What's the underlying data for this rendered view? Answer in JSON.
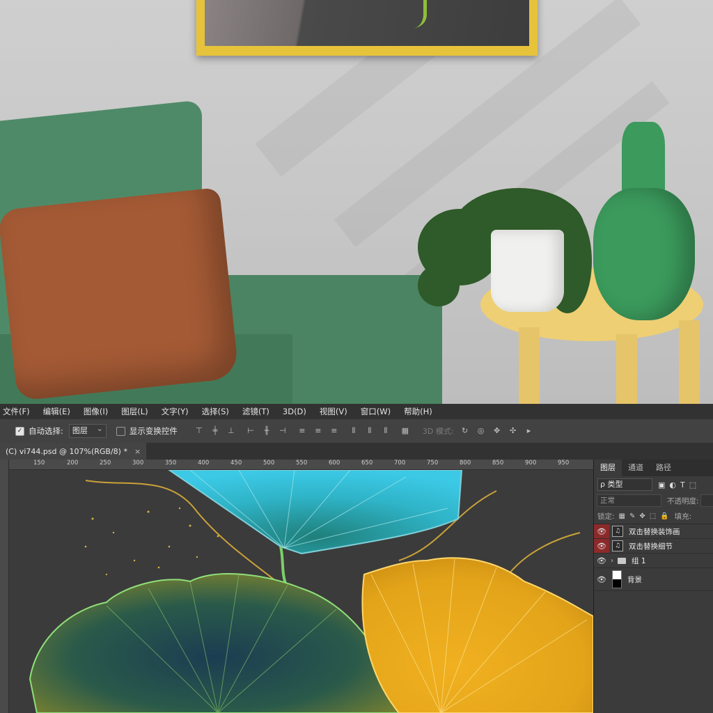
{
  "menubar": {
    "items": [
      "文件(F)",
      "编辑(E)",
      "图像(I)",
      "图层(L)",
      "文字(Y)",
      "选择(S)",
      "滤镜(T)",
      "3D(D)",
      "视图(V)",
      "窗口(W)",
      "帮助(H)"
    ]
  },
  "options": {
    "auto_select_label": "自动选择:",
    "auto_select_target": "图层",
    "show_transform_label": "显示变换控件",
    "mode_3d_label": "3D 模式:"
  },
  "document": {
    "tab_title": "(C) vi744.psd @ 107%(RGB/8) *",
    "close_glyph": "×"
  },
  "ruler": {
    "h_ticks": [
      "150",
      "200",
      "250",
      "300",
      "350",
      "400",
      "450",
      "500",
      "550",
      "600",
      "650",
      "700",
      "750",
      "800",
      "850",
      "900",
      "950"
    ]
  },
  "layers_panel": {
    "tabs": [
      "图层",
      "通道",
      "路径"
    ],
    "filter_label": "ρ 类型",
    "blend_mode": "正常",
    "opacity_label": "不透明度:",
    "lock_label": "锁定:",
    "fill_label": "填充:",
    "layers": [
      {
        "name": "双击替换装饰画",
        "type": "smart-object"
      },
      {
        "name": "双击替换细节",
        "type": "smart-object"
      },
      {
        "name": "组 1",
        "type": "group"
      },
      {
        "name": "背景",
        "type": "background"
      }
    ]
  },
  "colors": {
    "ui_dark": "#323232",
    "ui_panel": "#3b3b3b",
    "eye_highlight": "#8c2a2a",
    "frame_gold": "#e7c33b",
    "chair_green": "#4f8a68"
  }
}
